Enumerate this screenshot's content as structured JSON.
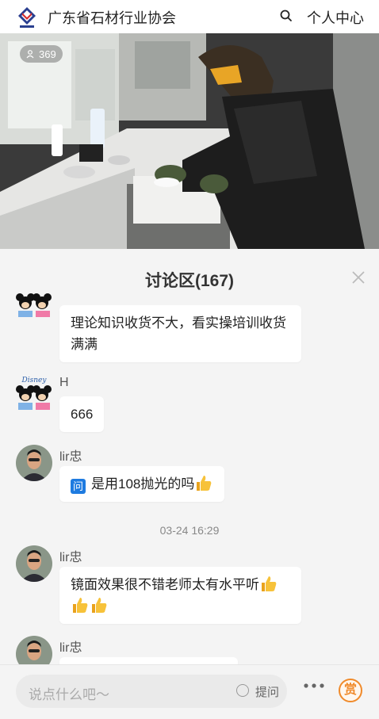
{
  "header": {
    "org_name": "广东省石材行业协会",
    "personal_center": "个人中心",
    "logo_icon": "association-logo",
    "search_icon": "search-icon"
  },
  "video": {
    "viewer_count": "369",
    "viewer_icon": "people-icon"
  },
  "discussion": {
    "title": "讨论区(167)",
    "close_icon": "close-icon",
    "messages": [
      {
        "user": "",
        "avatar": "cartoon-mickey-minnie-avatar",
        "text": "理论知识收货不大，看实操培训收货满满"
      },
      {
        "user": "H",
        "avatar": "cartoon-disney-avatar",
        "text": "666"
      },
      {
        "user": "lir忠",
        "avatar": "user-photo-avatar",
        "question_badge": "问",
        "text": "是用108抛光的吗",
        "emoji": "thumbs-up"
      },
      {
        "user": "lir忠",
        "avatar": "user-photo-avatar",
        "text": "镜面效果很不错老师太有水平听",
        "emoji": "thumbs-up"
      },
      {
        "user": "lir忠",
        "avatar": "user-photo-avatar",
        "text": ""
      }
    ],
    "timestamp": "03-24 16:29"
  },
  "bottom_bar": {
    "input_placeholder": "说点什么吧～",
    "ask_label": "提问",
    "more_icon": "more-dots-icon",
    "reward_label": "赏"
  },
  "colors": {
    "accent_blue": "#1e7be0",
    "reward_orange": "#f08a2a",
    "background": "#f4f4f4"
  }
}
